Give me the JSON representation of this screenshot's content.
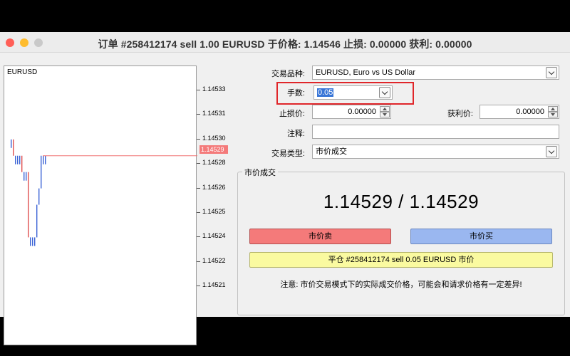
{
  "window": {
    "title": "订单 #258412174 sell 1.00 EURUSD 于价格: 1.14546 止损: 0.00000 获利: 0.00000"
  },
  "chart": {
    "symbol": "EURUSD",
    "price_ticks": [
      "1.14533",
      "1.14531",
      "1.14530",
      "1.14528",
      "1.14526",
      "1.14525",
      "1.14524",
      "1.14522",
      "1.14521"
    ],
    "current_price_tag": "1.14529",
    "colors": {
      "up_bar": "#3a63d6",
      "down_bar": "#e05050",
      "price_line": "#f07070"
    }
  },
  "chart_data": {
    "type": "line",
    "title": "EURUSD",
    "xlabel": "",
    "ylabel": "",
    "ylim": [
      1.14521,
      1.14533
    ],
    "series": [
      {
        "name": "EURUSD",
        "values": [
          1.1453,
          1.1453,
          1.14529,
          1.14529,
          1.14529,
          1.14529,
          1.14528,
          1.14528,
          1.14528,
          1.14524,
          1.14524,
          1.14524,
          1.14524,
          1.14526,
          1.14527,
          1.14529,
          1.14529,
          1.14529
        ]
      }
    ],
    "current_price": 1.14529,
    "grid": false
  },
  "form": {
    "symbol_label": "交易品种:",
    "symbol_value": "EURUSD, Euro vs US Dollar",
    "volume_label": "手数:",
    "volume_value": "0.05",
    "stop_loss_label": "止损价:",
    "stop_loss_value": "0.00000",
    "take_profit_label": "获利价:",
    "take_profit_value": "0.00000",
    "comment_label": "注释:",
    "comment_value": "",
    "type_label": "交易类型:",
    "type_value": "市价成交"
  },
  "market": {
    "group_title": "市价成交",
    "bid": "1.14529",
    "ask": "1.14529",
    "separator": " / ",
    "sell_button": "市价卖",
    "buy_button": "市价买",
    "close_button": "平仓 #258412174 sell 0.05 EURUSD 市价",
    "note": "注意: 市价交易模式下的实际成交价格，可能会和请求价格有一定差异!"
  }
}
